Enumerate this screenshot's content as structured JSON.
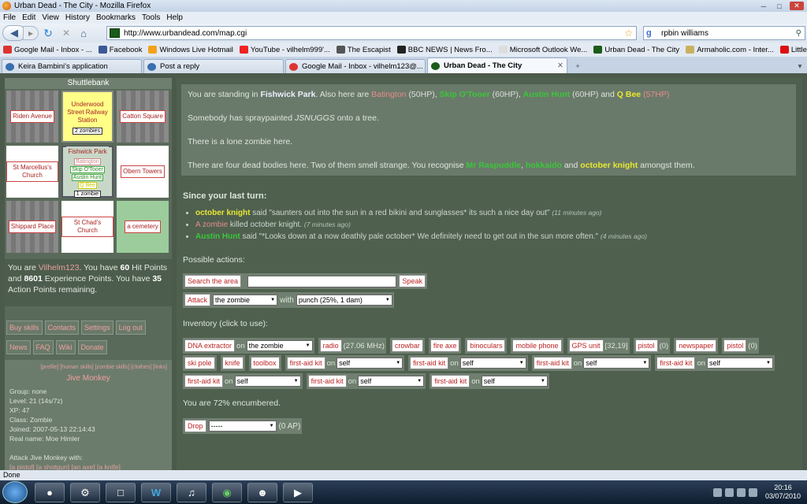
{
  "window": {
    "title": "Urban Dead - The City - Mozilla Firefox"
  },
  "menu": [
    "File",
    "Edit",
    "View",
    "History",
    "Bookmarks",
    "Tools",
    "Help"
  ],
  "nav": {
    "url": "http://www.urbandead.com/map.cgi",
    "search_value": "rpbin williams"
  },
  "bookmarks": [
    {
      "label": "Google Mail - Inbox - ...",
      "color": "#d33"
    },
    {
      "label": "Facebook",
      "color": "#3b5998"
    },
    {
      "label": "Windows Live Hotmail",
      "color": "#f3a21a"
    },
    {
      "label": "YouTube - vilhelm999'...",
      "color": "#e22"
    },
    {
      "label": "The Escapist",
      "color": "#555"
    },
    {
      "label": "BBC NEWS | News Fro...",
      "color": "#222"
    },
    {
      "label": "Microsoft Outlook We...",
      "color": "#ddd"
    },
    {
      "label": "Urban Dead - The City",
      "color": "#1a5c1a"
    },
    {
      "label": "Armaholic.com - Inter...",
      "color": "#c9b160"
    },
    {
      "label": "Little Gamers – Hot Sw...",
      "color": "#d11"
    }
  ],
  "tabs": [
    {
      "label": "Keira Bambini's application",
      "color": "#3a6fb0",
      "active": false
    },
    {
      "label": "Post a reply",
      "color": "#3a6fb0",
      "active": false
    },
    {
      "label": "Google Mail - Inbox - vilhelm123@...",
      "color": "#d33",
      "active": false
    },
    {
      "label": "Urban Dead - The City",
      "color": "#1a5c1a",
      "active": true
    }
  ],
  "left": {
    "suburb": "Shuttlebank",
    "map": [
      {
        "name": "Riden Avenue",
        "style": "gray"
      },
      {
        "name": "Underwood Street Railway Station",
        "style": "yellow",
        "zombies": "2 zombies"
      },
      {
        "name": "Catton Square",
        "style": "gray"
      },
      {
        "name": "St Marcellus's Church",
        "style": "white"
      },
      {
        "name": "Fishwick Park",
        "style": "center",
        "people": [
          "Batington",
          "Skip O'Tooer",
          "Austin Hunt",
          "Q Bee"
        ],
        "zombies": "1 zombie"
      },
      {
        "name": "Obern Towers",
        "style": "white"
      },
      {
        "name": "Shippard Place",
        "style": "gray"
      },
      {
        "name": "St Chad's Church",
        "style": "white"
      },
      {
        "name": "a cemetery",
        "style": "green"
      }
    ],
    "status": {
      "prefix": "You are",
      "name": "Vilhelm123",
      "t1": ". You have",
      "hp": "60",
      "t2": "Hit Points and",
      "xp": "8601",
      "t3": "Experience Points. You have",
      "ap": "35",
      "t4": "Action Points remaining."
    },
    "buttons1": [
      "Buy skills",
      "Contacts",
      "Settings",
      "Log out"
    ],
    "buttons2": [
      "News",
      "FAQ",
      "Wiki",
      "Donate"
    ],
    "profile": {
      "links": "[profile] [human skills] [zombie skills] [clothes] [links]",
      "name": "Jive Monkey",
      "lines": [
        "Group: none",
        "Level: 21 (14s/7z)",
        "XP: 47",
        "Class: Zombie",
        "Joined: 2007-05-13 22:14:43",
        "Real name: Moe Himler"
      ],
      "attack_label": "Attack Jive Monkey with:",
      "attacks": "[a pistol] [a shotgun] [an axe] [a knife]"
    }
  },
  "main": {
    "loc": {
      "p1a": "You are standing in",
      "place": "Fishwick Park",
      "p1b": ". Also here are",
      "n1": "Batington",
      "h1": "(50HP)",
      "n2": "Skip O'Tooer",
      "h2": "(60HP)",
      "n3": "Austin Hunt",
      "h3": "(60HP)",
      "and": "and",
      "n4": "Q Bee",
      "h4": "(57HP)",
      "graffiti_a": "Somebody has spraypainted",
      "graffiti": "JSNUGGS",
      "graffiti_b": "onto a tree.",
      "zombie": "There is a lone zombie here.",
      "bodies_a": "There are four dead bodies here. Two of them smell strange. You recognise",
      "b1": "Mr Raspuddle",
      "b2": "hokkaido",
      "b_and": "and",
      "b3": "october knight",
      "bodies_b": "amongst them."
    },
    "since": "Since your last turn:",
    "events": [
      {
        "who": "october knight",
        "what": "said \"saunters out into the sun in a red bikini and sunglasses* its such a nice day out\"",
        "time": "(11 minutes ago)",
        "color": "yellow"
      },
      {
        "who": "A zombie",
        "what": "killed october knight.",
        "time": "(7 minutes ago)",
        "color": "red"
      },
      {
        "who": "Austin Hunt",
        "what": "said \"*Looks down at a now deathly pale october* We definitely need to get out in the sun more often.\"",
        "time": "(4 minutes ago)",
        "color": "green"
      }
    ],
    "possible": "Possible actions:",
    "search_btn": "Search the area",
    "speak_btn": "Speak",
    "attack_btn": "Attack",
    "attack_target": "the zombie",
    "with": "with",
    "weapon": "punch (25%, 1 dam)",
    "inventory_label": "Inventory (click to use):",
    "inv_row1": [
      {
        "item": "DNA extractor",
        "extra": "on",
        "select": "the zombie"
      },
      {
        "item": "radio",
        "extra": "(27.06 MHz)"
      },
      {
        "item": "crowbar"
      },
      {
        "item": "fire axe"
      },
      {
        "item": "binoculars"
      },
      {
        "item": "mobile phone"
      },
      {
        "item": "GPS unit",
        "extra": "[32,19]"
      },
      {
        "item": "pistol",
        "extra": "(0)"
      },
      {
        "item": "newspaper"
      },
      {
        "item": "pistol",
        "extra": "(0)"
      }
    ],
    "inv_row2": [
      {
        "item": "ski pole"
      },
      {
        "item": "knife"
      },
      {
        "item": "toolbox"
      },
      {
        "item": "first-aid kit",
        "extra": "on",
        "select": "self"
      },
      {
        "item": "first-aid kit",
        "extra": "on",
        "select": "self"
      },
      {
        "item": "first-aid kit",
        "extra": "on",
        "select": "self"
      },
      {
        "item": "first-aid kit",
        "extra": "on",
        "select": "self"
      }
    ],
    "inv_row3": [
      {
        "item": "first-aid kit",
        "extra": "on",
        "select": "self"
      },
      {
        "item": "first-aid kit",
        "extra": "on",
        "select": "self"
      },
      {
        "item": "first-aid kit",
        "extra": "on",
        "select": "self"
      }
    ],
    "encumbered": "You are 72% encumbered.",
    "drop_btn": "Drop",
    "drop_select": "-----",
    "drop_ap": "(0 AP)"
  },
  "statusbar": "Done",
  "clock": {
    "time": "20:16",
    "date": "03/07/2010"
  }
}
